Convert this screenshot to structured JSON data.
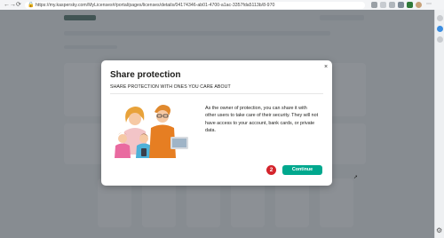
{
  "browser": {
    "url": "https://my.kaspersky.com/MyLicenses#/portal/pages/licenses/details/04174346-ab01-4700-a1ac-3357fda5113b/8-970",
    "lock_glyph": "🔒",
    "back_glyph": "←",
    "forward_glyph": "→",
    "reload_glyph": "⟳"
  },
  "modal": {
    "title": "Share protection",
    "subtitle": "SHARE PROTECTION WITH ONES YOU CARE ABOUT",
    "close_glyph": "×",
    "body": "As the owner of protection, you can share it with other users to take care of their security. They will not have access to your account, bank cards, or private data.",
    "step_number": "2",
    "continue_label": "Continue"
  },
  "colors": {
    "accent": "#00a88e",
    "step_badge": "#d4242c"
  },
  "icons": [
    "lock-icon",
    "close-icon",
    "family-illustration",
    "settings-icon"
  ]
}
